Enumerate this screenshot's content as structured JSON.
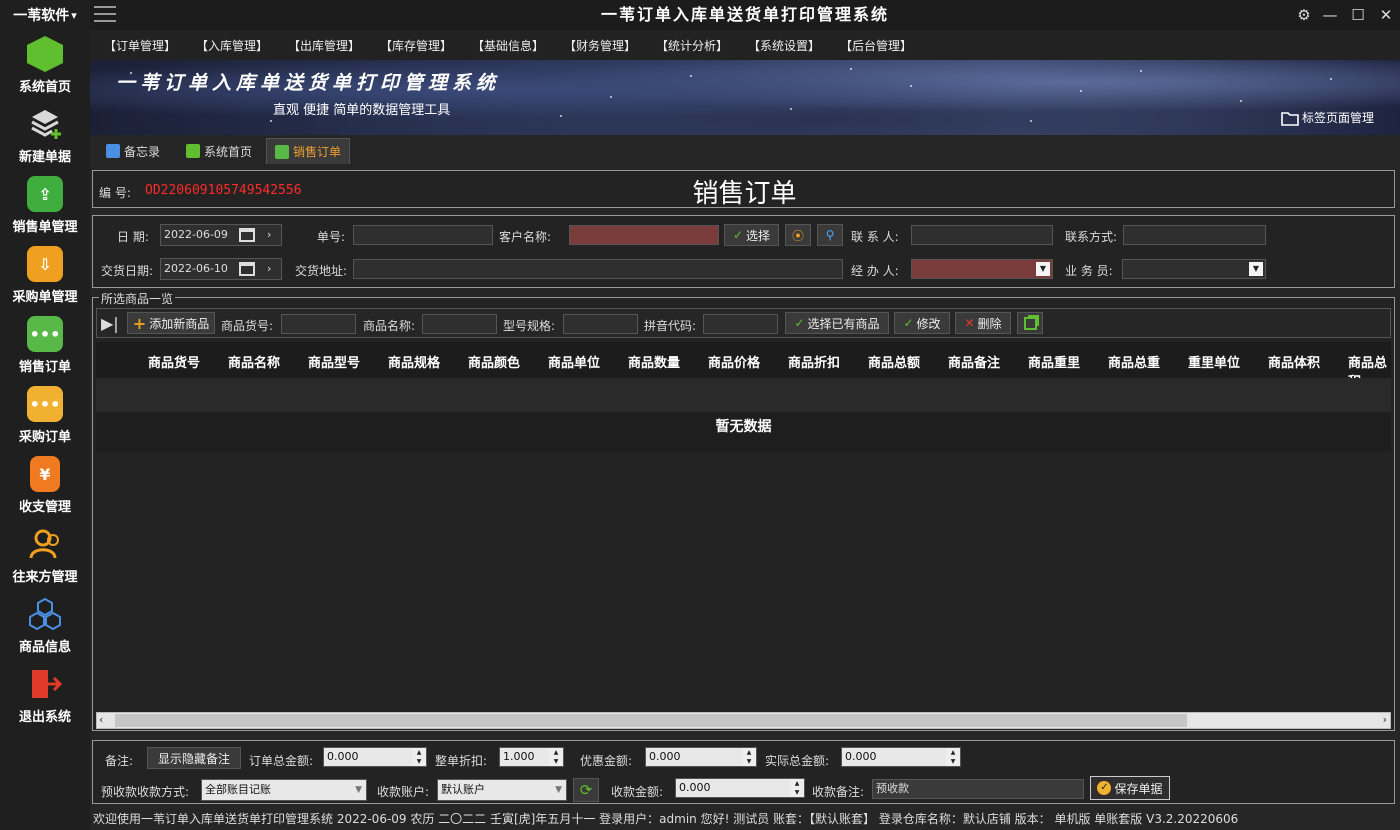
{
  "sidebar": {
    "brand": "一苇软件",
    "brand_arrow": "▾",
    "items": [
      {
        "label": "系统首页"
      },
      {
        "label": "新建单据"
      },
      {
        "label": "销售单管理"
      },
      {
        "label": "采购单管理"
      },
      {
        "label": "销售订单"
      },
      {
        "label": "采购订单"
      },
      {
        "label": "收支管理"
      },
      {
        "label": "往来方管理"
      },
      {
        "label": "商品信息"
      },
      {
        "label": "退出系统"
      }
    ],
    "icon_colors": [
      "#5fbf2f",
      "#cfcfcf",
      "#3fae3f",
      "#f0a020",
      "#58b848",
      "#f0b030",
      "#f07a20",
      "#f0a020",
      "#4a90e2",
      "#e03a2a"
    ]
  },
  "titlebar": {
    "title": "一苇订单入库单送货单打印管理系统",
    "settings_icon": "⚙",
    "minimize": "—",
    "maximize": "☐",
    "close": "✕"
  },
  "menu": [
    "【订单管理】",
    "【入库管理】",
    "【出库管理】",
    "【库存管理】",
    "【基础信息】",
    "【财务管理】",
    "【统计分析】",
    "【系统设置】",
    "【后台管理】"
  ],
  "banner": {
    "title": "一苇订单入库单送货单打印管理系统",
    "subtitle": "直观 便捷 简单的数据管理工具",
    "tab_manager": "标签页面管理"
  },
  "tabs": [
    {
      "label": "备忘录"
    },
    {
      "label": "系统首页"
    },
    {
      "label": "销售订单"
    }
  ],
  "header": {
    "order_no_label": "编 号:",
    "order_no": "OD220609105749542556",
    "form_title": "销售订单"
  },
  "form": {
    "date_label": "日 期:",
    "date_value": "2022-06-09",
    "doc_no_label": "单号:",
    "customer_label": "客户名称:",
    "select_button": "选择",
    "contact_label": "联 系 人:",
    "contact_way_label": "联系方式:",
    "delivery_date_label": "交货日期:",
    "delivery_date_value": "2022-06-10",
    "delivery_addr_label": "交货地址:",
    "handler_label": "经 办 人:",
    "salesman_label": "业 务 员:"
  },
  "products": {
    "legend": "所选商品一览",
    "add_button": "添加新商品",
    "code_label": "商品货号:",
    "name_label": "商品名称:",
    "spec_label": "型号规格:",
    "pinyin_label": "拼音代码:",
    "choose_existing": "选择已有商品",
    "edit": "修改",
    "delete": "删除",
    "columns": [
      "商品货号",
      "商品名称",
      "商品型号",
      "商品规格",
      "商品颜色",
      "商品单位",
      "商品数量",
      "商品价格",
      "商品折扣",
      "商品总额",
      "商品备注",
      "商品重里",
      "商品总重",
      "重里单位",
      "商品体积",
      "商品总积"
    ],
    "empty_text": "暂无数据"
  },
  "bottom": {
    "note_label": "备注:",
    "toggle_note": "显示隐藏备注",
    "order_total_label": "订单总金额:",
    "order_total": "0.000",
    "discount_label": "整单折扣:",
    "discount": "1.000",
    "coupon_label": "优惠金额:",
    "coupon": "0.000",
    "actual_total_label": "实际总金额:",
    "actual_total": "0.000",
    "prepay_method_label": "预收款收款方式:",
    "prepay_method": "全部账目记账",
    "account_label": "收款账户:",
    "account": "默认账户",
    "amount_label": "收款金额:",
    "amount": "0.000",
    "receipt_note_label": "收款备注:",
    "receipt_note": "预收款",
    "save_button": "保存单据"
  },
  "status": "欢迎使用一苇订单入库单送货单打印管理系统 2022-06-09 农历 二〇二二 壬寅[虎]年五月十一 登录用户：admin 您好! 测试员 账套：【默认账套】 登录仓库名称：默认店铺 版本： 单机版 单账套版 V3.2.20220606"
}
